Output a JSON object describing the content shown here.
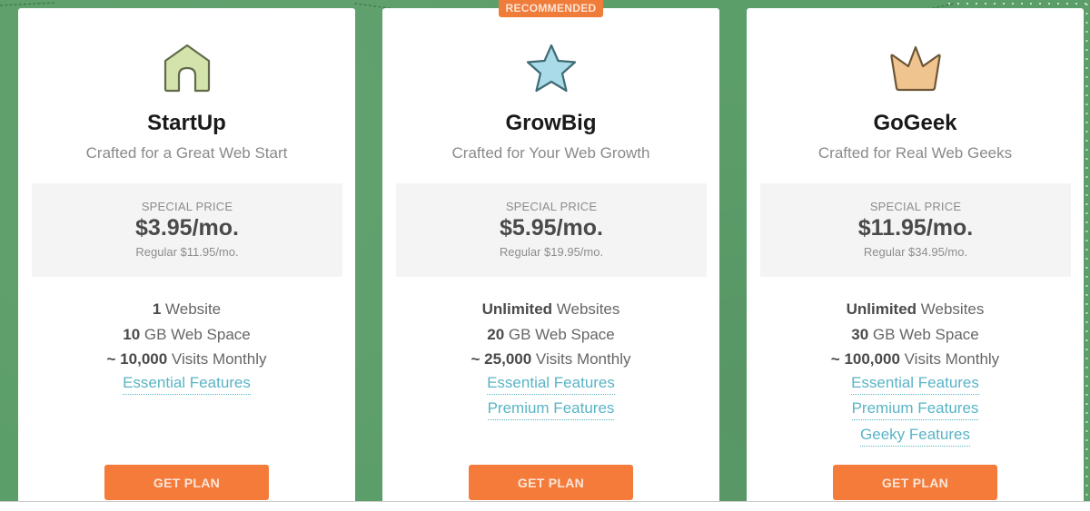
{
  "colors": {
    "background": "#5c9e6a",
    "accent_orange": "#f47b3a",
    "link_teal": "#5ab4c5",
    "price_box": "#f4f4f4"
  },
  "plans": [
    {
      "name": "StartUp",
      "tagline": "Crafted for a Great Web Start",
      "icon": "house-icon",
      "icon_color": "#d4e3ab",
      "badge": null,
      "price_label": "SPECIAL PRICE",
      "price": "$3.95/mo.",
      "regular_price": "Regular $11.95/mo.",
      "features": [
        {
          "strong": "1",
          "text": " Website"
        },
        {
          "strong": "10",
          "text": " GB Web Space"
        },
        {
          "strong": "~ 10,000",
          "text": " Visits Monthly"
        }
      ],
      "links": [
        "Essential Features"
      ],
      "cta": "GET PLAN"
    },
    {
      "name": "GrowBig",
      "tagline": "Crafted for Your Web Growth",
      "icon": "star-icon",
      "icon_color": "#a9dbe8",
      "badge": "RECOMMENDED",
      "price_label": "SPECIAL PRICE",
      "price": "$5.95/mo.",
      "regular_price": "Regular $19.95/mo.",
      "features": [
        {
          "strong": "Unlimited",
          "text": " Websites"
        },
        {
          "strong": "20",
          "text": " GB Web Space"
        },
        {
          "strong": "~ 25,000",
          "text": " Visits Monthly"
        }
      ],
      "links": [
        "Essential Features",
        "Premium Features"
      ],
      "cta": "GET PLAN"
    },
    {
      "name": "GoGeek",
      "tagline": "Crafted for Real Web Geeks",
      "icon": "crown-icon",
      "icon_color": "#f0c48e",
      "badge": null,
      "price_label": "SPECIAL PRICE",
      "price": "$11.95/mo.",
      "regular_price": "Regular $34.95/mo.",
      "features": [
        {
          "strong": "Unlimited",
          "text": " Websites"
        },
        {
          "strong": "30",
          "text": " GB Web Space"
        },
        {
          "strong": "~ 100,000",
          "text": " Visits Monthly"
        }
      ],
      "links": [
        "Essential Features",
        "Premium Features",
        "Geeky Features"
      ],
      "cta": "GET PLAN"
    }
  ]
}
